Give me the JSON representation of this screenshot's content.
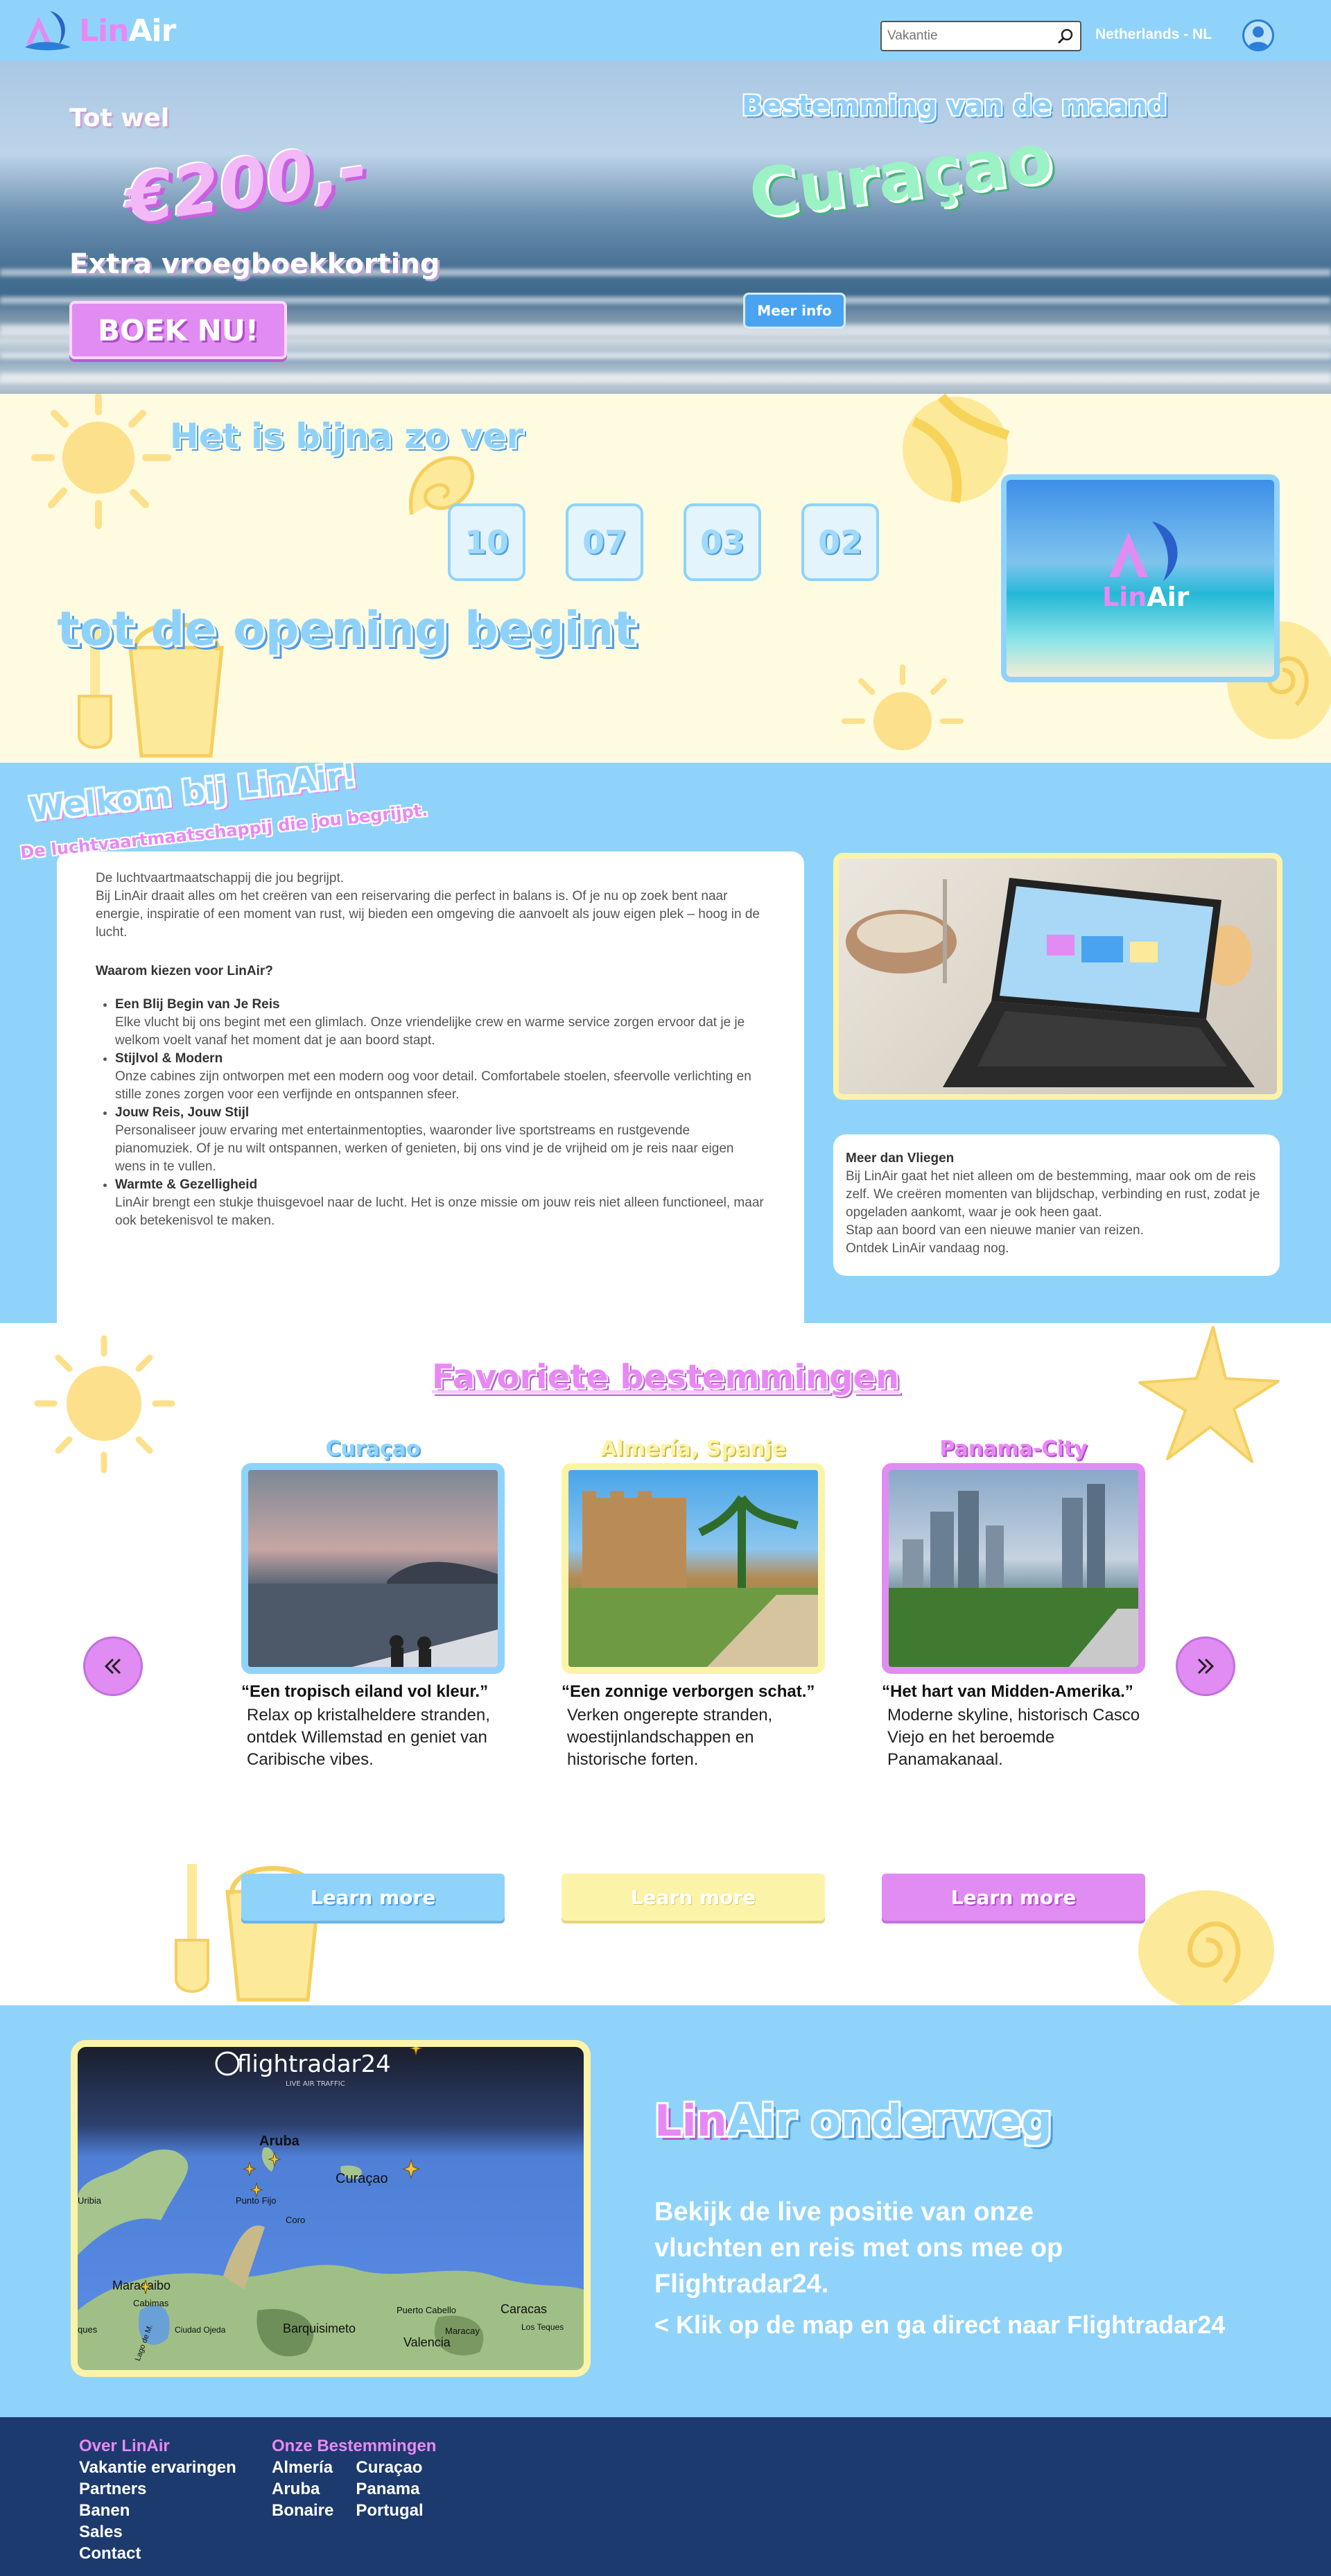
{
  "brand": {
    "lin": "Lin",
    "air": "Air",
    "logo_letter": "A"
  },
  "header": {
    "search_placeholder": "Vakantie",
    "locale": "Netherlands - NL"
  },
  "hero": {
    "upto": "Tot wel",
    "amount": "€200,-",
    "discount": "Extra vroegboekkorting",
    "book_label": "BOEK NU!",
    "dest_label": "Bestemming van de maand",
    "dest_name": "Curaçao",
    "info_label": "Meer info"
  },
  "countdown": {
    "title": "Het is bijna zo ver",
    "values": [
      "10",
      "07",
      "03",
      "02"
    ],
    "subtitle": "tot de opening begint"
  },
  "welcome": {
    "title": "Welkom bij LinAir!",
    "subtitle": "De luchtvaartmaatschappij die jou begrijpt.",
    "intro1": "De luchtvaartmaatschappij die jou begrijpt.",
    "intro2": "Bij LinAir draait alles om het creëren van een reiservaring die perfect in balans is. Of je nu op zoek bent naar energie, inspiratie of een moment van rust, wij bieden een omgeving die aanvoelt als jouw eigen plek – hoog in de lucht.",
    "why": "Waarom kiezen voor LinAir?",
    "points": [
      {
        "title": "Een Blij Begin van Je Reis",
        "text": "Elke vlucht bij ons begint met een glimlach. Onze vriendelijke crew en warme service zorgen ervoor dat je je welkom voelt vanaf het moment dat je aan boord stapt."
      },
      {
        "title": "Stijlvol & Modern",
        "text": "Onze cabines zijn ontworpen met een modern oog voor detail. Comfortabele stoelen, sfeervolle verlichting en stille zones zorgen voor een verfijnde en ontspannen sfeer."
      },
      {
        "title": "Jouw Reis, Jouw Stijl",
        "text": "Personaliseer jouw ervaring met entertainmentopties, waaronder live sportstreams en rustgevende pianomuziek. Of je nu wilt ontspannen, werken of genieten, bij ons vind je de vrijheid om je reis naar eigen wens in te vullen."
      },
      {
        "title": "Warmte & Gezelligheid",
        "text": "LinAir brengt een stukje thuisgevoel naar de lucht. Het is onze missie om jouw reis niet alleen functioneel, maar ook betekenisvol te maken."
      }
    ],
    "more_title": "Meer dan Vliegen",
    "more_text1": "Bij LinAir gaat het niet alleen om de bestemming, maar ook om de reis zelf. We creëren momenten van blijdschap, verbinding en rust, zodat je opgeladen aankomt, waar je ook heen gaat.",
    "more_text2": "Stap aan boord van een nieuwe manier van reizen.",
    "more_text3": "Ontdek LinAir vandaag nog."
  },
  "favorites": {
    "title": "Favoriete bestemmingen",
    "items": [
      {
        "name": "Curaçao",
        "quote": "“Een tropisch eiland vol kleur.”",
        "desc": "Relax op kristalheldere stranden, ontdek Willemstad en geniet van Caribische vibes.",
        "button": "Learn more"
      },
      {
        "name": "Almería, Spanje",
        "quote": "“Een zonnige verborgen schat.”",
        "desc": "Verken ongerepte stranden, woestijnlandschappen en historische forten.",
        "button": "Learn more"
      },
      {
        "name": "Panama-City",
        "quote": "“Het hart van Midden-Amerika.”",
        "desc": "Moderne skyline, historisch Casco Viejo en het beroemde Panamakanaal.",
        "button": "Learn more"
      }
    ],
    "colors": {
      "curacao": "#8fd3fb",
      "almeria": "#fbf4a8",
      "panama": "#e18cf2"
    }
  },
  "tracker": {
    "title_rest": " onderweg",
    "desc": "Bekijk de live positie van onze vluchten en reis met ons mee op Flightradar24.",
    "link": "< Klik op de map en ga direct naar Flightradar24",
    "map_brand": "flightradar24",
    "map_tag": "LIVE AIR TRAFFIC",
    "map_labels": [
      "Aruba",
      "Curaçao",
      "Aruba",
      "Curaçao",
      "Punto Fijo",
      "Coro",
      "Maracaibo",
      "Cabimas",
      "Barquisimeto",
      "Caracas",
      "Valencia",
      "Maracay",
      "Puerto Cabello",
      "Ciudad Ojeda",
      "Uribia",
      "Lago de M.",
      "Los Teques",
      "ques"
    ]
  },
  "footer": {
    "col1_title": "Over LinAir",
    "col1": [
      "Vakantie ervaringen",
      "Partners",
      "Banen",
      "Sales",
      "Contact"
    ],
    "col2_title": "Onze Bestemmingen",
    "col2a": [
      "Almería",
      "Aruba",
      "Bonaire"
    ],
    "col2b": [
      "Curaçao",
      "Panama",
      "Portugal"
    ]
  }
}
